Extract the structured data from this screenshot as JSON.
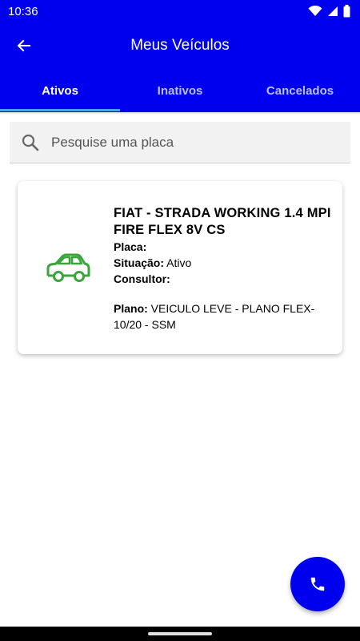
{
  "status_bar": {
    "time": "10:36"
  },
  "app_bar": {
    "title": "Meus Veículos"
  },
  "tabs": [
    {
      "label": "Ativos",
      "active": true
    },
    {
      "label": "Inativos",
      "active": false
    },
    {
      "label": "Cancelados",
      "active": false
    }
  ],
  "search": {
    "placeholder": "Pesquise uma placa",
    "value": ""
  },
  "vehicle_card": {
    "title": "FIAT - STRADA WORKING 1.4 MPI FIRE FLEX 8V CS",
    "placa_label": "Placa:",
    "placa_value": "",
    "situacao_label": "Situação:",
    "situacao_value": "Ativo",
    "consultor_label": "Consultor:",
    "consultor_value": "",
    "plano_label": "Plano:",
    "plano_value": "VEICULO LEVE - PLANO FLEX-10/20 - SSM",
    "icon": "car-icon",
    "icon_color": "#3aa53a"
  },
  "fab": {
    "icon": "phone-icon"
  },
  "colors": {
    "primary": "#0000ee",
    "tab_indicator": "#3fa8e8"
  }
}
